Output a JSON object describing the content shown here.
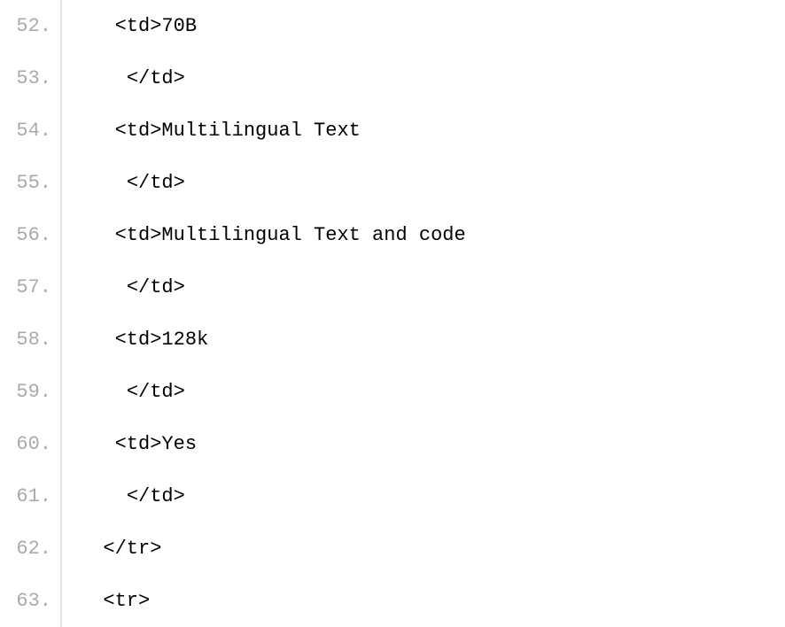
{
  "code_lines": [
    {
      "number": "52.",
      "indent": "   ",
      "tag_open": "<td>",
      "text": "70B",
      "tag_close": ""
    },
    {
      "number": "53.",
      "indent": "    ",
      "tag_open": "</td>",
      "text": "",
      "tag_close": ""
    },
    {
      "number": "54.",
      "indent": "   ",
      "tag_open": "<td>",
      "text": "Multilingual Text",
      "tag_close": ""
    },
    {
      "number": "55.",
      "indent": "    ",
      "tag_open": "</td>",
      "text": "",
      "tag_close": ""
    },
    {
      "number": "56.",
      "indent": "   ",
      "tag_open": "<td>",
      "text": "Multilingual Text and code",
      "tag_close": ""
    },
    {
      "number": "57.",
      "indent": "    ",
      "tag_open": "</td>",
      "text": "",
      "tag_close": ""
    },
    {
      "number": "58.",
      "indent": "   ",
      "tag_open": "<td>",
      "text": "128k",
      "tag_close": ""
    },
    {
      "number": "59.",
      "indent": "    ",
      "tag_open": "</td>",
      "text": "",
      "tag_close": ""
    },
    {
      "number": "60.",
      "indent": "   ",
      "tag_open": "<td>",
      "text": "Yes",
      "tag_close": ""
    },
    {
      "number": "61.",
      "indent": "    ",
      "tag_open": "</td>",
      "text": "",
      "tag_close": ""
    },
    {
      "number": "62.",
      "indent": "  ",
      "tag_open": "</tr>",
      "text": "",
      "tag_close": ""
    },
    {
      "number": "63.",
      "indent": "  ",
      "tag_open": "<tr>",
      "text": "",
      "tag_close": ""
    }
  ]
}
